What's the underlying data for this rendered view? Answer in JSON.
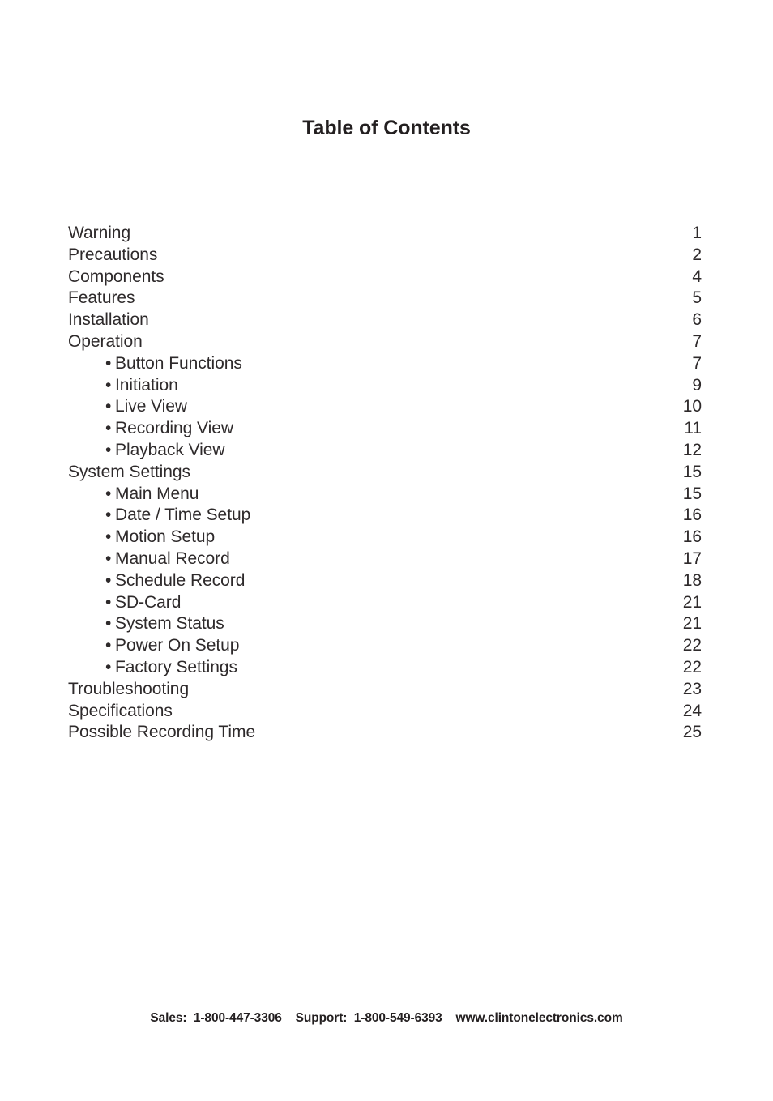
{
  "document": {
    "title": "Table of Contents"
  },
  "toc": {
    "entries": [
      {
        "label": "Warning",
        "page": "1",
        "level": 0
      },
      {
        "label": "Precautions",
        "page": "2",
        "level": 0
      },
      {
        "label": "Components",
        "page": "4",
        "level": 0
      },
      {
        "label": "Features",
        "page": "5",
        "level": 0
      },
      {
        "label": "Installation",
        "page": "6",
        "level": 0
      },
      {
        "label": "Operation",
        "page": "7",
        "level": 0
      },
      {
        "label": "Button Functions",
        "page": "7",
        "level": 1
      },
      {
        "label": "Initiation",
        "page": "9",
        "level": 1
      },
      {
        "label": "Live View",
        "page": "10",
        "level": 1
      },
      {
        "label": "Recording View",
        "page": "11",
        "level": 1
      },
      {
        "label": "Playback View",
        "page": "12",
        "level": 1
      },
      {
        "label": "System Settings",
        "page": "15",
        "level": 0
      },
      {
        "label": "Main Menu",
        "page": "15",
        "level": 1
      },
      {
        "label": "Date / Time Setup",
        "page": "16",
        "level": 1
      },
      {
        "label": "Motion Setup",
        "page": "16",
        "level": 1
      },
      {
        "label": "Manual Record",
        "page": "17",
        "level": 1
      },
      {
        "label": "Schedule Record",
        "page": "18",
        "level": 1
      },
      {
        "label": "SD-Card",
        "page": "21",
        "level": 1
      },
      {
        "label": "System Status",
        "page": "21",
        "level": 1
      },
      {
        "label": "Power On Setup",
        "page": "22",
        "level": 1
      },
      {
        "label": "Factory Settings",
        "page": "22",
        "level": 1
      },
      {
        "label": "Troubleshooting",
        "page": "23",
        "level": 0
      },
      {
        "label": "Specifications",
        "page": "24",
        "level": 0
      },
      {
        "label": "Possible Recording Time",
        "page": "25",
        "level": 0
      }
    ],
    "bullet_glyph": "•"
  },
  "footer": {
    "text": "Sales:  1-800-447-3306    Support:  1-800-549-6393    www.clintonelectronics.com",
    "sales_label": "Sales:",
    "sales_phone": "1-800-447-3306",
    "support_label": "Support:",
    "support_phone": "1-800-549-6393",
    "website": "www.clintonelectronics.com"
  },
  "colors": {
    "text": "#231f20",
    "background": "#ffffff"
  }
}
